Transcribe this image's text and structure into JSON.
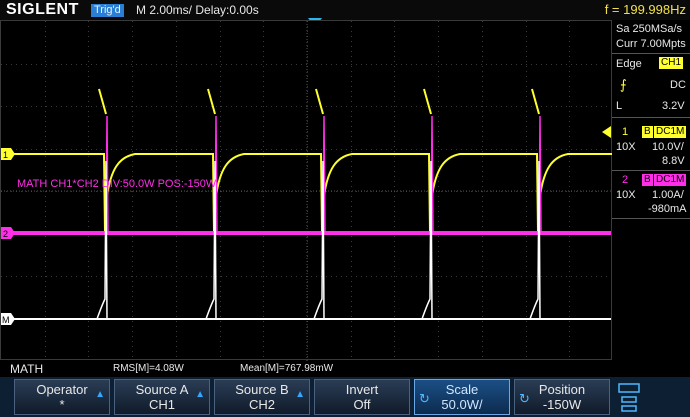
{
  "header": {
    "brand": "SIGLENT",
    "trigger_status": "Trig'd",
    "timebase": "M 2.00ms/ Delay:0.00s",
    "frequency": "f = 199.998Hz"
  },
  "side_panel": {
    "sample_rate": "Sa 250MSa/s",
    "memory": "Curr 7.00Mpts",
    "trigger_type": "Edge",
    "trigger_source": "CH1",
    "trigger_slope_icon": "rising-edge-icon",
    "trigger_coupling": "DC",
    "trigger_level_label": "L",
    "trigger_level": "3.2V",
    "ch1": {
      "number": "1",
      "bandwidth_badge": "B",
      "coupling": "DC1M",
      "probe": "10X",
      "scale": "10.0V/",
      "offset": "8.8V",
      "color": "#ffff2e"
    },
    "ch2": {
      "number": "2",
      "bandwidth_badge": "B",
      "coupling": "DC1M",
      "probe": "10X",
      "scale": "1.00A/",
      "offset": "-980mA",
      "color": "#ff2ee8"
    }
  },
  "screen": {
    "math_label": "MATH  CH1*CH2  DIV:50.0W  POS:-150W",
    "marker_ch1": "1",
    "marker_ch2": "2",
    "marker_math": "M",
    "math_color": "#ffffff"
  },
  "measurements": {
    "title": "MATH",
    "rms": "RMS[M]=4.08W",
    "mean": "Mean[M]=767.98mW"
  },
  "menu": {
    "buttons": [
      {
        "label": "Operator",
        "value": "*"
      },
      {
        "label": "Source A",
        "value": "CH1"
      },
      {
        "label": "Source B",
        "value": "CH2"
      },
      {
        "label": "Invert",
        "value": "Off"
      },
      {
        "label": "Scale",
        "value": "50.0W/"
      },
      {
        "label": "Position",
        "value": "-150W"
      }
    ]
  }
}
